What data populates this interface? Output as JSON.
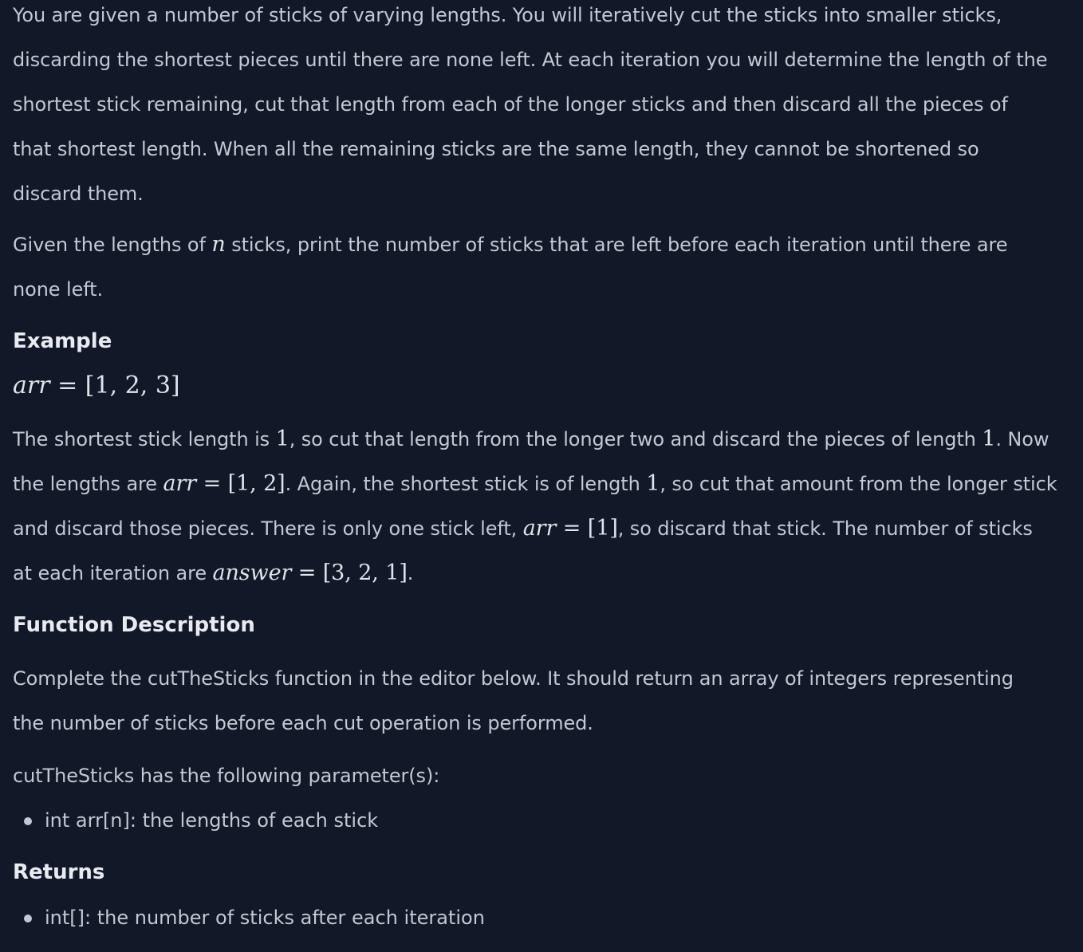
{
  "intro": {
    "p1_text": "You are given a number of sticks of varying lengths. You will iteratively cut the sticks into smaller sticks, discarding the shortest pieces until there are none left. At each iteration you will determine the length of the shortest stick remaining, cut that length from each of the longer sticks and then discard all the pieces of that shortest length. When all the remaining sticks are the same length, they cannot be shortened so discard them.",
    "p2_before": "Given the lengths of ",
    "p2_var": "n",
    "p2_after": " sticks, print the number of sticks that are left before each iteration until there are none left."
  },
  "example": {
    "heading": "Example",
    "arr_var": "arr",
    "arr_eq": " = ",
    "arr_value": "[1, 2, 3]",
    "explain": {
      "t1": "The shortest stick length is ",
      "m1": "1",
      "t2": ", so cut that length from the longer two and discard the pieces of length ",
      "m2": "1",
      "t3": ". Now the lengths are ",
      "m3_var": "arr",
      "m3_rest": " = [1, 2]",
      "t4": ". Again, the shortest stick is of length ",
      "m4": "1",
      "t5": ", so cut that amount from the longer stick and discard those pieces. There is only one stick left, ",
      "m5_var": "arr",
      "m5_rest": " = [1]",
      "t6": ", so discard that stick. The number of sticks at each iteration are ",
      "m6_var": "answer",
      "m6_rest": " = [3, 2, 1]",
      "t7": "."
    }
  },
  "function_description": {
    "heading": "Function Description",
    "text": "Complete the cutTheSticks function in the editor below. It should return an array of integers representing the number of sticks before each cut operation is performed.",
    "params_intro": "cutTheSticks has the following parameter(s):",
    "params": [
      "int arr[n]: the lengths of each stick"
    ]
  },
  "returns": {
    "heading": "Returns",
    "items": [
      "int[]: the number of sticks after each iteration"
    ]
  }
}
